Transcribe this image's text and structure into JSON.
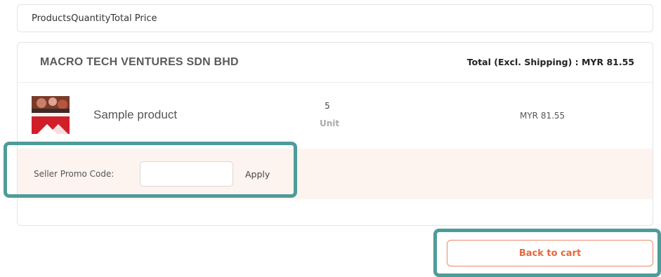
{
  "header": {
    "columns_text": "ProductsQuantityTotal Price"
  },
  "order": {
    "seller_name": "MACRO TECH VENTURES SDN BHD",
    "total_label": "Total (Excl. Shipping) : MYR 81.55",
    "product": {
      "name": "Sample product",
      "quantity": "5",
      "unit": "Unit",
      "price": "MYR 81.55"
    },
    "promo": {
      "label": "Seller Promo Code:",
      "value": "",
      "placeholder": "",
      "apply_label": "Apply"
    }
  },
  "actions": {
    "back_label": "Back to cart"
  },
  "colors": {
    "accent": "#e5673f",
    "highlight": "#4e9c99",
    "promo_background": "#fdf3ef"
  }
}
